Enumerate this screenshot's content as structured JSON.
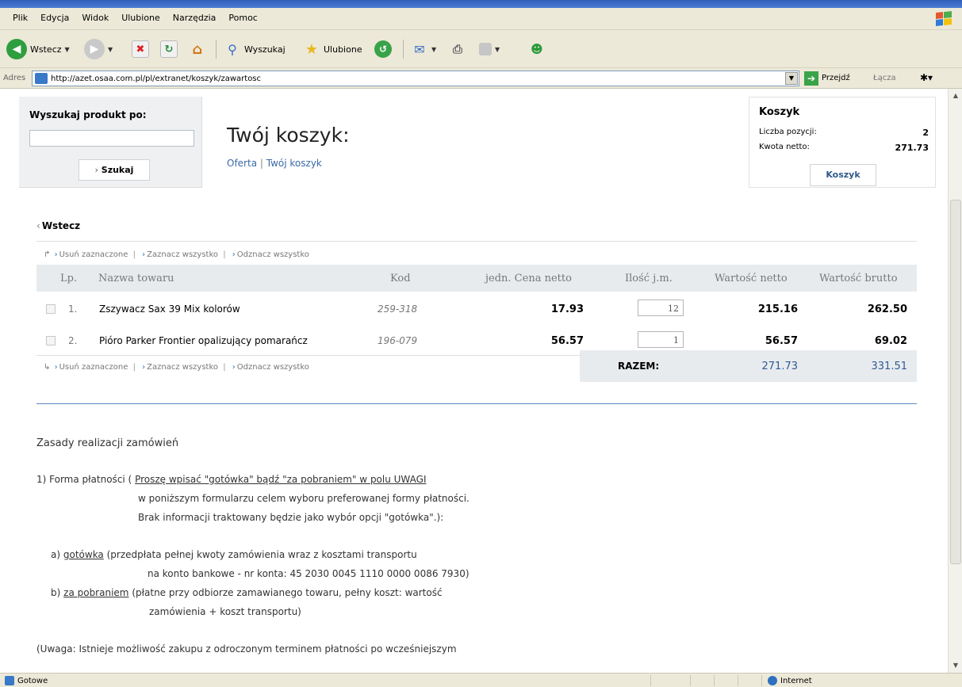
{
  "browser": {
    "menu": [
      "Plik",
      "Edycja",
      "Widok",
      "Ulubione",
      "Narzędzia",
      "Pomoc"
    ],
    "toolbar": {
      "back_label": "Wstecz",
      "search_label": "Wyszukaj",
      "favorites_label": "Ulubione"
    },
    "address": {
      "label": "Adres",
      "url": "http://azet.osaa.com.pl/pl/extranet/koszyk/zawartosc",
      "go_label": "Przejdź",
      "links_label": "Łącza"
    },
    "status": {
      "text": "Gotowe",
      "zone": "Internet"
    }
  },
  "search": {
    "title": "Wyszukaj produkt po:",
    "value": "",
    "button": "Szukaj"
  },
  "page": {
    "title": "Twój koszyk:",
    "breadcrumb": [
      "Oferta",
      "Twój koszyk"
    ],
    "back": "Wstecz"
  },
  "cart": {
    "title": "Koszyk",
    "items_label": "Liczba pozycji:",
    "items_value": "2",
    "net_label": "Kwota netto:",
    "net_value": "271.73",
    "button": "Koszyk"
  },
  "actions": {
    "delete": "Usuń zaznaczone",
    "select_all": "Zaznacz wszystko",
    "deselect_all": "Odznacz wszystko"
  },
  "table": {
    "headers": {
      "lp": "Lp.",
      "name": "Nazwa towaru",
      "code": "Kod",
      "unit_price": "jedn. Cena netto",
      "qty": "Ilość j.m.",
      "net": "Wartość netto",
      "gross": "Wartość brutto"
    },
    "rows": [
      {
        "lp": "1.",
        "name": "Zszywacz Sax 39 Mix kolorów",
        "code": "259-318",
        "unit_price": "17.93",
        "qty": "12",
        "net": "215.16",
        "gross": "262.50"
      },
      {
        "lp": "2.",
        "name": "Pióro Parker Frontier opalizujący pomarańcz",
        "code": "196-079",
        "unit_price": "56.57",
        "qty": "1",
        "net": "56.57",
        "gross": "69.02"
      }
    ],
    "total": {
      "label": "RAZEM:",
      "net": "271.73",
      "gross": "331.51"
    }
  },
  "terms": {
    "heading": "Zasady realizacji zamówień",
    "p1_prefix": "1) Forma płatności (",
    "p1_link": "Proszę wpisać \"gotówka\" bądź \"za pobraniem\" w polu UWAGI",
    "p1_line2": "w poniższym formularzu celem wyboru preferowanej formy płatności.",
    "p1_line3": "Brak informacji traktowany będzie jako wybór opcji \"gotówka\".):",
    "a_prefix": "a)",
    "a_link": "gotówka",
    "a_rest": "(przedpłata pełnej kwoty zamówienia wraz z kosztami transportu",
    "a_line2": "na konto bankowe - nr konta: 45 2030 0045 1110 0000 0086 7930)",
    "b_prefix": "b)",
    "b_link": "za pobraniem",
    "b_rest": "(płatne przy odbiorze zamawianego towaru, pełny koszt: wartość",
    "b_line2": "zamówienia + koszt transportu)",
    "note": "(Uwaga: Istnieje możliwość zakupu z odroczonym terminem płatności po wcześniejszym"
  }
}
